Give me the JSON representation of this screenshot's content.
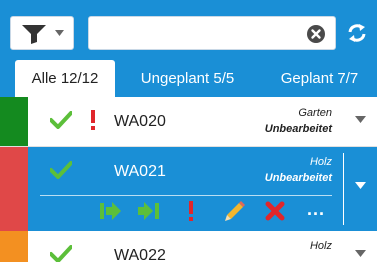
{
  "toolbar": {
    "filter_icon": "funnel-icon",
    "search": {
      "value": "",
      "placeholder": ""
    },
    "clear_icon": "clear-circle-icon",
    "refresh_icon": "refresh-arrows-icon"
  },
  "tabs": [
    {
      "label": "Alle 12/12",
      "active": true
    },
    {
      "label": "Ungeplant 5/5",
      "active": false
    },
    {
      "label": "Geplant 7/7",
      "active": false
    }
  ],
  "rows": [
    {
      "code": "WA020",
      "type": "Garten",
      "status": "Unbearbeitet",
      "stripe_color": "#148a1f",
      "checked": true,
      "flagged": true,
      "selected": false
    },
    {
      "code": "WA021",
      "type": "Holz",
      "status": "Unbearbeitet",
      "stripe_color": "#e04848",
      "checked": true,
      "flagged": false,
      "selected": true
    },
    {
      "code": "WA022",
      "type": "Holz",
      "status": "",
      "stripe_color": "#f39021",
      "checked": true,
      "flagged": false,
      "selected": false
    }
  ],
  "actions": {
    "icons": [
      "start-arrow-icon",
      "skip-arrow-icon",
      "exclamation-icon",
      "pencil-icon",
      "delete-x-icon"
    ],
    "more_label": "..."
  },
  "colors": {
    "accent": "#1a8fd6",
    "check_green": "#5cbf3a",
    "exclamation_red": "#e0262b"
  }
}
